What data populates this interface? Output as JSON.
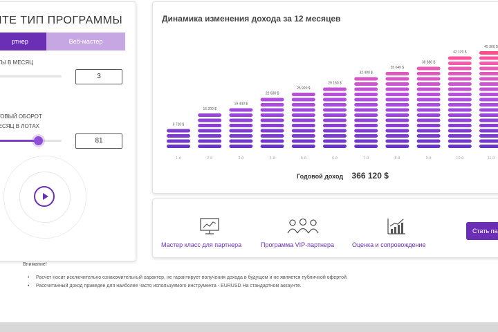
{
  "left_panel": {
    "title": "ИТЕ ТИП ПРОГРАММЫ",
    "tabs": [
      "ртнер",
      "Веб-мастер"
    ],
    "field1_label": "НТЫ В МЕСЯЦ",
    "field1_value": "3",
    "field1_fill": 0.0,
    "field2_label_line1": "РГОВЫЙ ОБОРОТ",
    "field2_label_line2": "МЕСЯЦ В ЛОТАХ",
    "field2_value": "81",
    "field2_fill": 0.65,
    "play_icon": "play-icon"
  },
  "chart_panel": {
    "title": "Динамика изменения дохода за 12 месяцев",
    "annual_label": "Годовой доход",
    "annual_value": "366 120 $"
  },
  "chart_data": {
    "type": "bar",
    "categories": [
      "1-й",
      "2-й",
      "3-й",
      "4-й",
      "5-й",
      "6-й",
      "7-й",
      "8-й",
      "9-й",
      "10-й",
      "11-й"
    ],
    "values": [
      9720,
      16200,
      19440,
      22680,
      25920,
      29160,
      32400,
      35640,
      38880,
      42120,
      45360
    ],
    "value_labels": [
      "9 720 $",
      "16 200 $",
      "19 440 $",
      "22 680 $",
      "25 920 $",
      "29 160 $",
      "32 400 $",
      "35 640 $",
      "38 880 $",
      "42 120 $",
      "45 360 $"
    ],
    "ylim": [
      0,
      45360
    ],
    "colors": {
      "low": "#6a35c7",
      "mid": "#b04ee0",
      "high": "#f05fb0",
      "top": "#ff4d8a"
    }
  },
  "features": [
    {
      "icon": "chart-screen-icon",
      "label": "Мастер класс для партнера"
    },
    {
      "icon": "people-group-icon",
      "label": "Программа VIP-партнера"
    },
    {
      "icon": "growth-chart-icon",
      "label": "Оценка и сопровождение"
    }
  ],
  "cta_label": "Стать па",
  "notes": {
    "title": "Внимание!",
    "items": [
      "Расчет носит исключительно ознакомительный характер, не гарантирует получения дохода в будущем и не является публичной офертой.",
      "Рассчитанный доход приведен для наиболее часто используемого инструмента - EURUSD На стандартном аккаунте."
    ]
  },
  "theme": {
    "accent": "#6b2fb5",
    "accent_light": "#c6a7e4"
  }
}
